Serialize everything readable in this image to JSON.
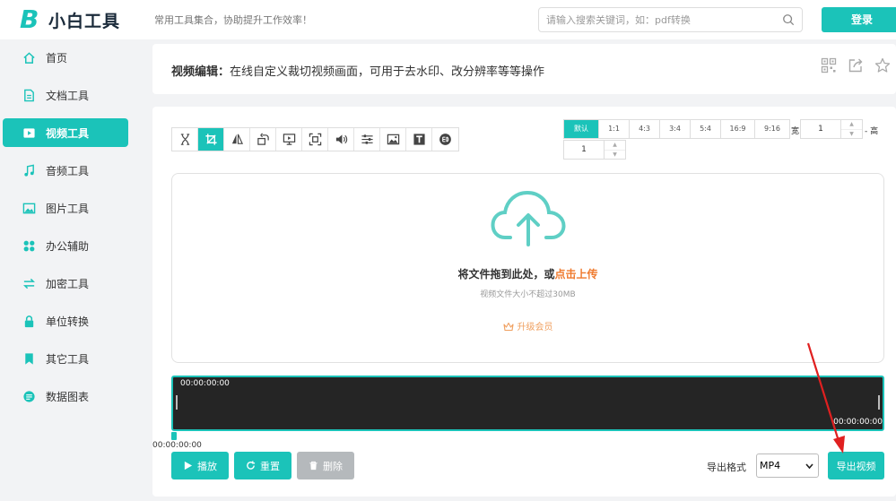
{
  "header": {
    "logo_mark": "B",
    "logo_text": "小白工具",
    "slogan": "常用工具集合，协助提升工作效率！",
    "search_placeholder": "请输入搜索关键词，如：pdf转换",
    "login_label": "登录"
  },
  "sidebar": {
    "items": [
      {
        "label": "首页",
        "icon": "home-icon"
      },
      {
        "label": "文档工具",
        "icon": "document-icon"
      },
      {
        "label": "视频工具",
        "icon": "video-icon",
        "active": true
      },
      {
        "label": "音频工具",
        "icon": "music-icon"
      },
      {
        "label": "图片工具",
        "icon": "image-icon"
      },
      {
        "label": "办公辅助",
        "icon": "apps-icon"
      },
      {
        "label": "加密工具",
        "icon": "swap-icon"
      },
      {
        "label": "单位转换",
        "icon": "lock-icon"
      },
      {
        "label": "其它工具",
        "icon": "bookmark-icon"
      },
      {
        "label": "数据图表",
        "icon": "chart-icon"
      }
    ]
  },
  "page": {
    "title_bold": "视频编辑：",
    "title_rest": "在线自定义裁切视频画面，可用于去水印、改分辨率等等操作"
  },
  "toolbar": {
    "tools": [
      "trim-icon",
      "crop-icon",
      "flip-icon",
      "rotate-icon",
      "screen-icon",
      "capture-icon",
      "volume-icon",
      "adjust-icon",
      "picture-icon",
      "text-icon",
      "subtitle-icon"
    ],
    "active_index": 1
  },
  "ratios": {
    "options": [
      "默认",
      "1:1",
      "4:3",
      "3:4",
      "5:4",
      "16:9",
      "9:16"
    ],
    "active_index": 0,
    "width_label": "宽",
    "width_value": "1",
    "height_label": "- 高",
    "height_value": "1"
  },
  "upload": {
    "prompt": "将文件拖到此处，或",
    "link": "点击上传",
    "limit": "视频文件大小不超过30MB",
    "vip": "升级会员"
  },
  "timeline": {
    "start": "00:00:00:00",
    "end": "00:00:00:00",
    "cursor_time": "00:00:00:00"
  },
  "actions": {
    "play": "播放",
    "reset": "重置",
    "delete": "删除",
    "format_label": "导出格式",
    "format_value": "MP4",
    "export": "导出视频"
  },
  "colors": {
    "accent": "#1bc3b9",
    "orange": "#ef7a2e",
    "arrow": "#e02020"
  }
}
